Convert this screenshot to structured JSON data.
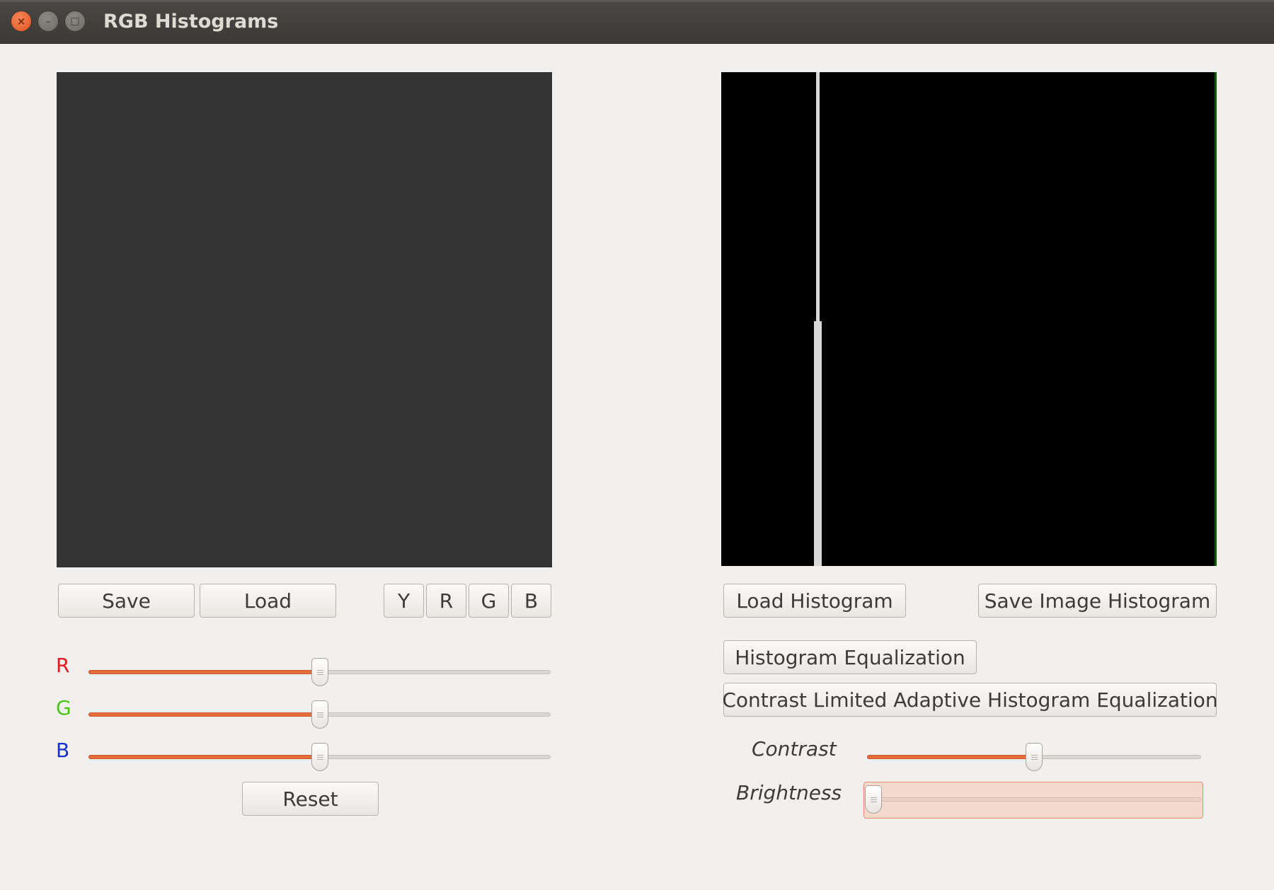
{
  "window": {
    "title": "RGB Histograms",
    "close_glyph": "×",
    "min_glyph": "–",
    "max_glyph": "□"
  },
  "left": {
    "save_label": "Save",
    "load_label": "Load",
    "channel_buttons": [
      "Y",
      "R",
      "G",
      "B"
    ],
    "sliders": [
      {
        "label": "R",
        "color": "#e8151c",
        "value": 0.5
      },
      {
        "label": "G",
        "color": "#4bc514",
        "value": 0.5
      },
      {
        "label": "B",
        "color": "#1b2fd6",
        "value": 0.5
      }
    ],
    "reset_label": "Reset"
  },
  "right": {
    "load_histogram_label": "Load Histogram",
    "save_image_histogram_label": "Save Image Histogram",
    "histogram_equalization_label": "Histogram Equalization",
    "clahe_label": "Contrast Limited Adaptive Histogram Equalization",
    "contrast": {
      "label": "Contrast",
      "value": 0.5
    },
    "brightness": {
      "label": "Brightness",
      "value": 0.0
    }
  },
  "colors": {
    "accent": "#e56b3c",
    "image_bg": "#333333",
    "histogram_bg": "#000000"
  }
}
